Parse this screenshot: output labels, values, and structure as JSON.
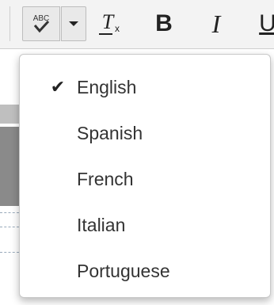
{
  "toolbar": {
    "spellcheck_icon": "spellcheck-abc-icon",
    "spellcheck_text": "ABC",
    "dropdown_icon": "caret-down-icon",
    "clear_format_icon": "clear-format-icon",
    "clear_format_glyph": "T",
    "clear_format_sub": "x",
    "bold_glyph": "B",
    "italic_glyph": "I",
    "underline_glyph": "U"
  },
  "language_menu": {
    "check_glyph": "✔",
    "items": [
      {
        "label": "English",
        "selected": true
      },
      {
        "label": "Spanish",
        "selected": false
      },
      {
        "label": "French",
        "selected": false
      },
      {
        "label": "Italian",
        "selected": false
      },
      {
        "label": "Portuguese",
        "selected": false
      }
    ]
  }
}
